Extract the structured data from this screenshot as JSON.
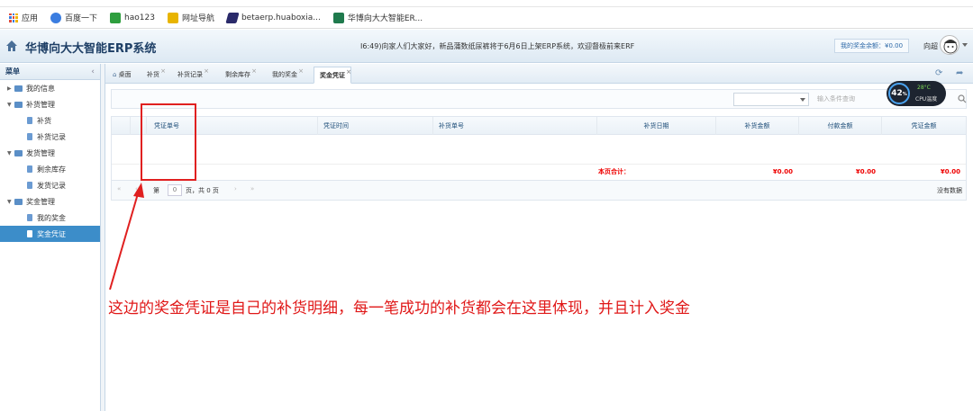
{
  "browser": {
    "bookmarks": [
      {
        "label": "应用",
        "color": "#e04a3a"
      },
      {
        "label": "百度一下",
        "color": "#3b7de0"
      },
      {
        "label": "hao123",
        "color": "#2e9e3e"
      },
      {
        "label": "网址导航",
        "color": "#e8b400"
      },
      {
        "label": "betaerp.huaboxia...",
        "color": "#2a2a6a"
      },
      {
        "label": "华博向大大智能ER...",
        "color": "#1f7a4d"
      }
    ]
  },
  "header": {
    "title": "华博向大大智能ERP系统",
    "marquee": "I6:49)向家人们大家好，新品蒲数纸尿裤将于6月6日上架ERP系统，欢迎督极前来ERF",
    "balance": "我的奖金余额：¥0.00",
    "username": "向超"
  },
  "sidebar": {
    "title": "菜单",
    "items": [
      {
        "label": "我的信息"
      },
      {
        "label": "补货管理"
      },
      {
        "label": "补货"
      },
      {
        "label": "补货记录"
      },
      {
        "label": "发货管理"
      },
      {
        "label": "剩余库存"
      },
      {
        "label": "发货记录"
      },
      {
        "label": "奖金管理"
      },
      {
        "label": "我的奖金"
      },
      {
        "label": "奖金凭证"
      }
    ]
  },
  "tabs": [
    "桌面",
    "补货",
    "补货记录",
    "剩余库存",
    "我的奖金",
    "奖金凭证"
  ],
  "search": {
    "placeholder": "输入条件查询"
  },
  "cpu": {
    "percent": "42",
    "unit": "%",
    "temp": "28°C",
    "label": "CPU温度"
  },
  "grid": {
    "columns": [
      "凭证单号",
      "凭证时间",
      "补货单号",
      "补货日期",
      "补货金额",
      "付款金额",
      "凭证金额"
    ],
    "footer": {
      "label": "本页合计：",
      "v1": "¥0.00",
      "v2": "¥0.00",
      "v3": "¥0.00"
    },
    "pager": {
      "page_prefix": "第",
      "page_value": "0",
      "page_suffix": "页，共 0 页",
      "no_data": "没有数据"
    }
  },
  "annotation": "这边的奖金凭证是自己的补货明细，每一笔成功的补货都会在这里体现，并且计入奖金"
}
